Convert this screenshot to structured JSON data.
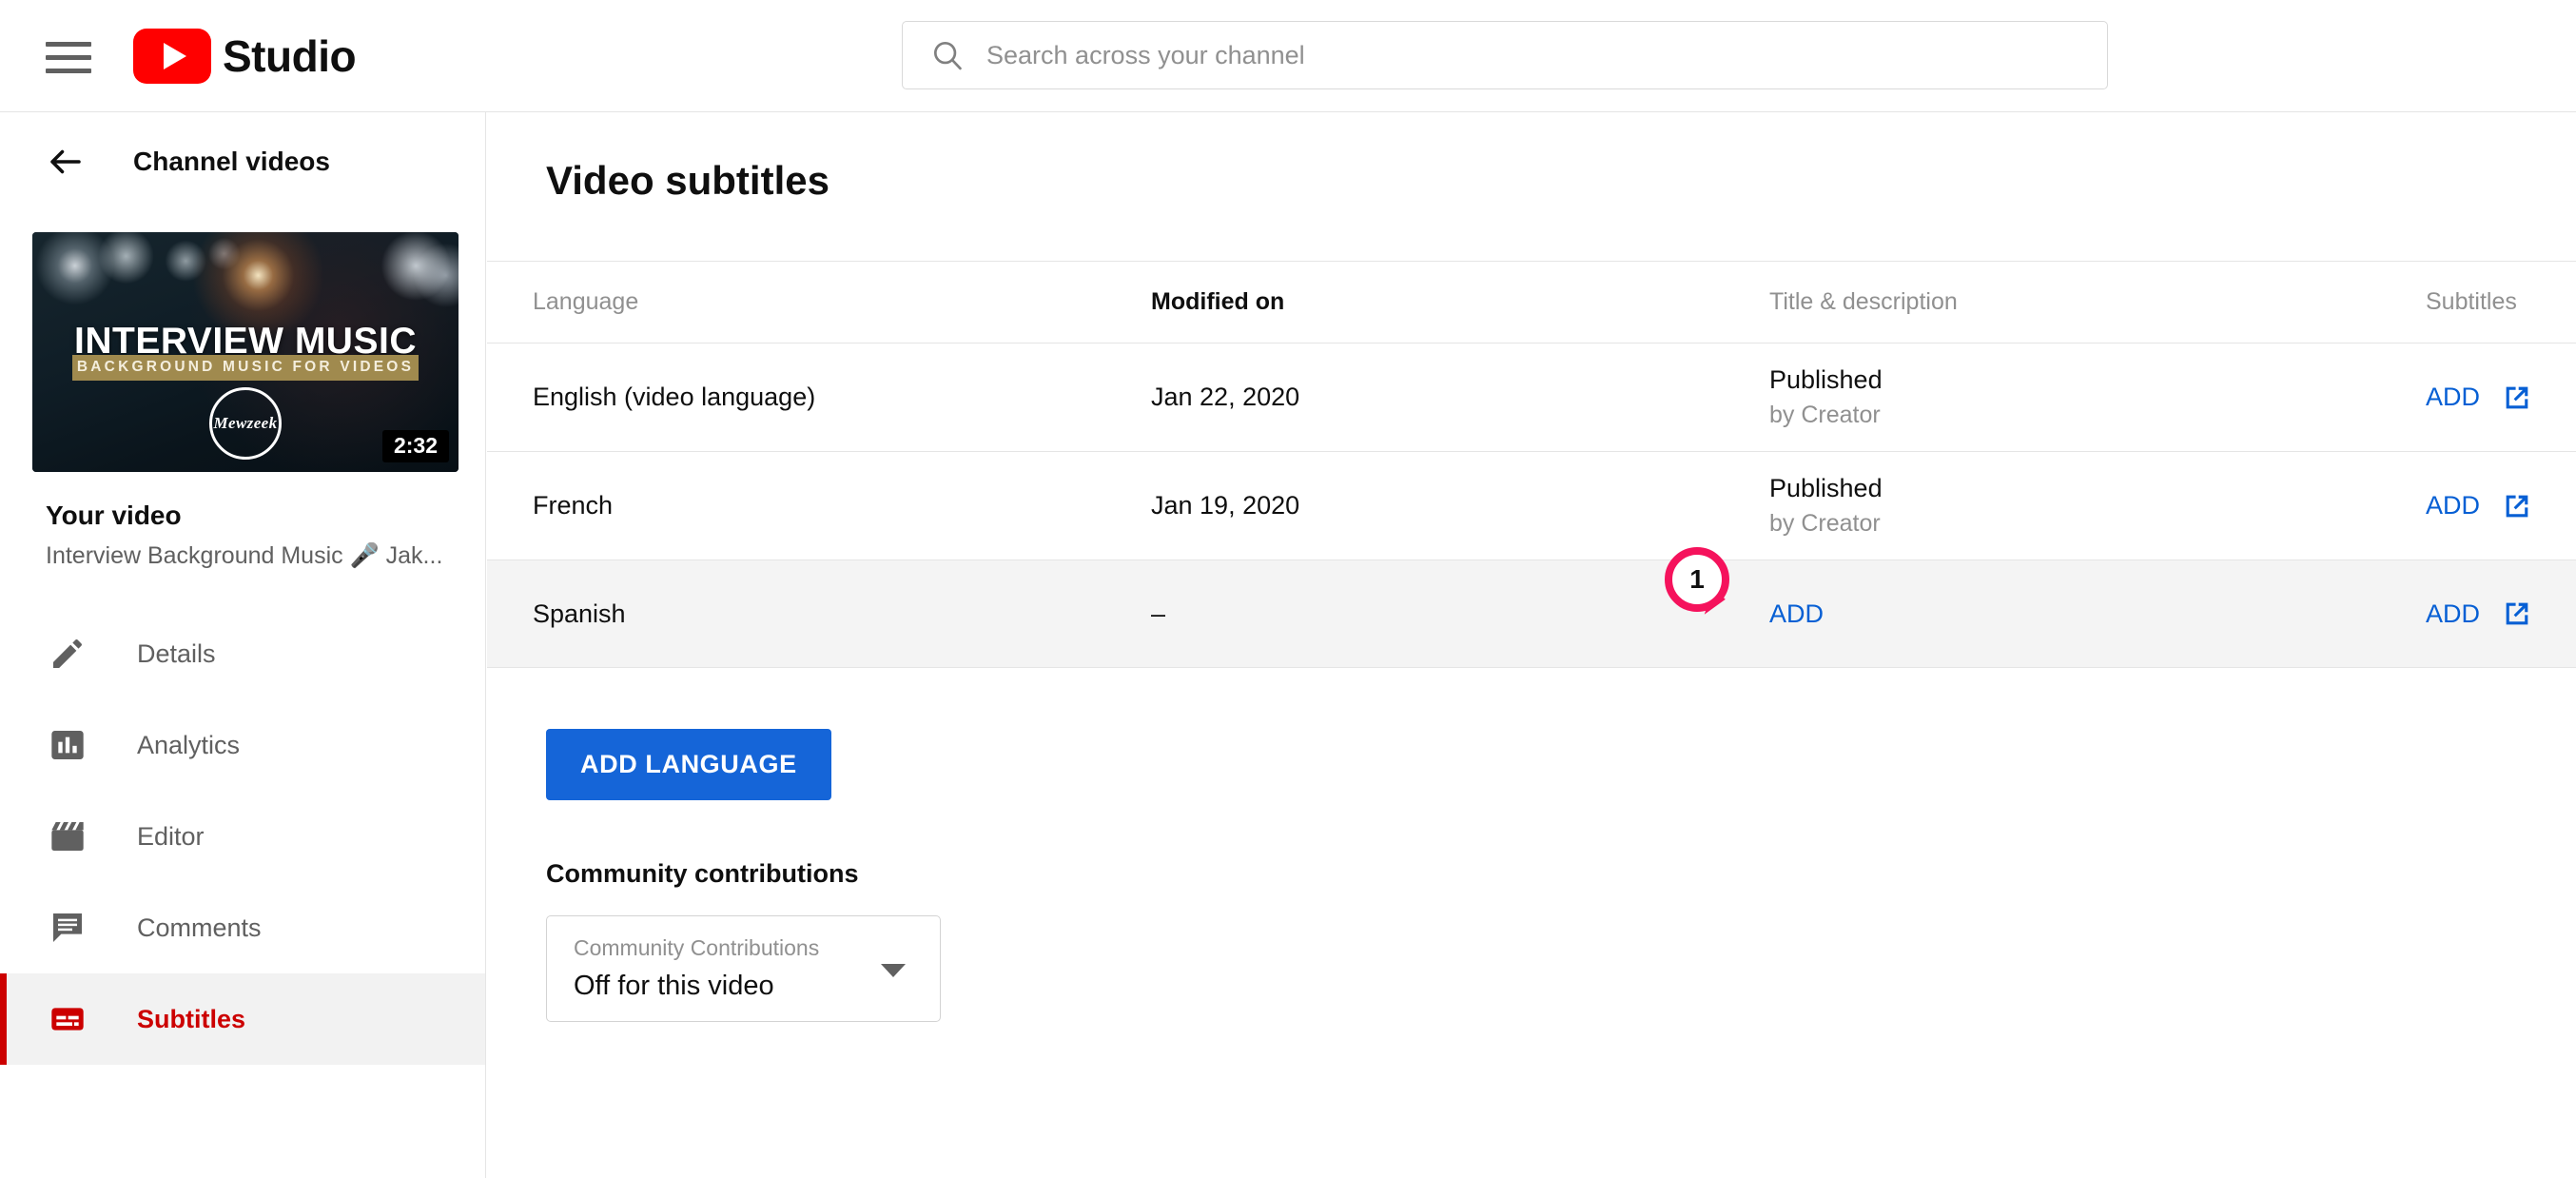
{
  "topbar": {
    "menu_icon": "hamburger-icon",
    "brand": "Studio",
    "logo_icon": "youtube-logo-icon",
    "search": {
      "icon": "search-icon",
      "placeholder": "Search across your channel",
      "value": ""
    }
  },
  "sidebar": {
    "back_icon": "arrow-left-icon",
    "back_label": "Channel videos",
    "thumbnail": {
      "title": "INTERVIEW MUSIC",
      "subtitle": "BACKGROUND MUSIC FOR VIDEOS",
      "watermark": "Mewzeek",
      "duration": "2:32"
    },
    "your_video_label": "Your video",
    "video_name": "Interview Background Music 🎤 Jak...",
    "items": [
      {
        "label": "Details",
        "icon": "pencil-icon",
        "active": false
      },
      {
        "label": "Analytics",
        "icon": "bar-chart-icon",
        "active": false
      },
      {
        "label": "Editor",
        "icon": "clapboard-icon",
        "active": false
      },
      {
        "label": "Comments",
        "icon": "comment-icon",
        "active": false
      },
      {
        "label": "Subtitles",
        "icon": "subtitles-icon",
        "active": true
      }
    ]
  },
  "main": {
    "page_title": "Video subtitles",
    "table": {
      "columns": [
        "Language",
        "Modified on",
        "Title & description",
        "Subtitles"
      ],
      "rows": [
        {
          "language": "English (video language)",
          "modified_on": "Jan 22, 2020",
          "title_status": "Published",
          "title_by": "by Creator",
          "title_link": "",
          "subtitles_action": "ADD",
          "subtitles_icon": "open-in-new-icon",
          "shaded": false
        },
        {
          "language": "French",
          "modified_on": "Jan 19, 2020",
          "title_status": "Published",
          "title_by": "by Creator",
          "title_link": "",
          "subtitles_action": "ADD",
          "subtitles_icon": "open-in-new-icon",
          "shaded": false
        },
        {
          "language": "Spanish",
          "modified_on": "–",
          "title_status": "",
          "title_by": "",
          "title_link": "ADD",
          "subtitles_action": "ADD",
          "subtitles_icon": "open-in-new-icon",
          "shaded": true
        }
      ]
    },
    "add_language_button": "ADD LANGUAGE",
    "community": {
      "heading": "Community contributions",
      "select_label": "Community Contributions",
      "select_value": "Off for this video",
      "caret_icon": "chevron-down-icon"
    }
  },
  "annotation": {
    "marker_number": "1",
    "marker_color": "#f5125c"
  }
}
